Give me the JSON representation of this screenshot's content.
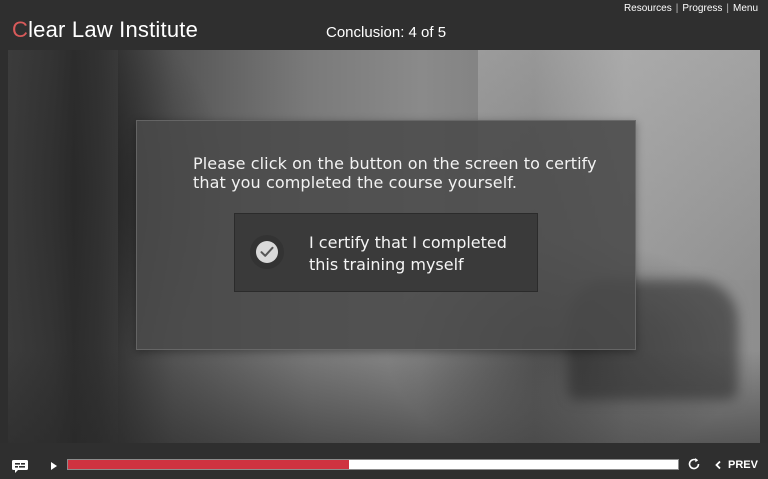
{
  "header": {
    "brand_first_letter": "C",
    "brand_rest": "lear Law Institute",
    "slide_title": "Conclusion: 4 of 5",
    "nav": {
      "resources": "Resources",
      "progress": "Progress",
      "menu": "Menu",
      "separator": "|"
    }
  },
  "dialog": {
    "instruction_line1": "Please click on the button on the screen to certify",
    "instruction_line2": "that you completed the course yourself.",
    "certify_button": {
      "line1": "I certify that I completed",
      "line2": "this training myself",
      "icon": "check-circle-icon"
    }
  },
  "player": {
    "captions_icon": "closed-captions-icon",
    "play_icon": "play-icon",
    "progress_percent": 46,
    "replay_icon": "replay-icon",
    "prev_label": "PREV",
    "prev_icon": "chevron-left-icon"
  },
  "colors": {
    "brand_accent": "#d95a5a",
    "progress_fill": "#cf3340",
    "progress_track": "#ffffff",
    "chrome_bg": "#2f2f2f",
    "dialog_bg": "#4a4a4a"
  }
}
